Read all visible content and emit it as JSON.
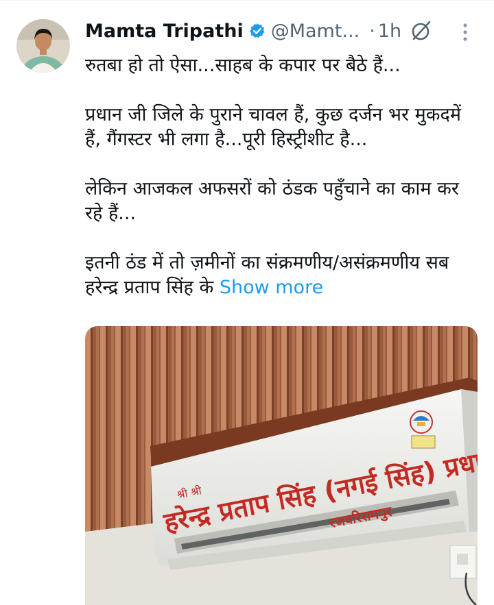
{
  "tweet": {
    "author_name": "Mamta Tripathi",
    "handle": "@Mamt...",
    "separator": "·",
    "time": "1h",
    "verified": true,
    "paragraphs": [
      "रुतबा हो तो ऐसा...साहब के कपार पर बैठे हैं...",
      "प्रधान जी जिले के पुराने चावल हैं, कुछ दर्जन भर मुकदमें हैं, गैंगस्टर भी लगा है...पूरी हिस्ट्रीशीट है...",
      "लेकिन आजकल अफसरों को ठंडक पहुँचाने का काम कर रहे हैं...",
      "इतनी ठंड में तो ज़मीनों का संक्रमणीय/असंक्रमणीय सब हरेन्द्र प्रताप सिंह के"
    ],
    "show_more_label": "Show more"
  },
  "media": {
    "sign_prefix": "श्री श्री",
    "sign_text": "हरेन्द्र प्रताप सिंह (नगई सिंह) प्रधान",
    "sign_place": "रजवरिरामपुर"
  },
  "colors": {
    "link": "#1d9bf0",
    "secondary": "#536471",
    "verified": "#1d9bf0"
  }
}
